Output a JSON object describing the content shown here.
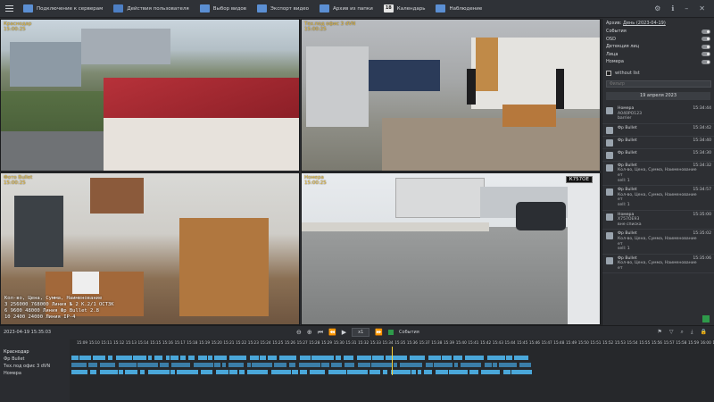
{
  "toolbar": {
    "buttons": [
      {
        "label": "Подключение к серверам",
        "icon": "server-icon"
      },
      {
        "label": "Действия пользователя",
        "icon": "user-icon"
      },
      {
        "label": "Выбор видов",
        "icon": "grid-icon"
      },
      {
        "label": "Экспорт видео",
        "icon": "export-icon"
      },
      {
        "label": "Архив из папки",
        "icon": "folder-icon"
      },
      {
        "label": "Календарь",
        "icon": "calendar-icon",
        "badge": "18"
      },
      {
        "label": "Наблюдение",
        "icon": "monitor-icon"
      }
    ]
  },
  "cameras": [
    {
      "label": "Краснодар",
      "timestamp": "15:00:25"
    },
    {
      "label": "Тех.под офис 3 dVN",
      "timestamp": "15:00:25"
    },
    {
      "label": "Фото Bullet",
      "timestamp": "15:00:25"
    },
    {
      "label": "Номера",
      "timestamp": "15:00:25"
    }
  ],
  "overlay": {
    "header": "Кол-во, Цена, Сумма, Наименование",
    "rows": [
      "3      256000   768000  Линия № 2 К.2/1 ОСТ3К",
      "6       9600   48000  Линия Фр Bullet 2.8",
      "10      2400   24000  Линия IP-4"
    ]
  },
  "plate_tag": "К757ОЕ",
  "panel": {
    "archive_label": "Архив:",
    "archive_date": "День (2023-04-19)",
    "filters": [
      "События",
      "OSD",
      "Детекция лиц",
      "Лица",
      "Номера"
    ],
    "without_list": "without list",
    "search_placeholder": "Фильтр",
    "date_bar": "19 апреля 2023",
    "events": [
      {
        "title": "Номера",
        "time": "15:34:44",
        "lines": [
          "А040РО123",
          "barrier"
        ]
      },
      {
        "title": "Фр Bullet",
        "time": "15:34:42",
        "lines": []
      },
      {
        "title": "Фр Bullet",
        "time": "15:34:40",
        "lines": []
      },
      {
        "title": "Фр Bullet",
        "time": "15:34:30",
        "lines": []
      },
      {
        "title": "Фр Bullet",
        "time": "15:34:32",
        "lines": [
          "Кол-во, Цена, Сумма, Наименование",
          "ет",
          "sell: 1"
        ]
      },
      {
        "title": "Фр Bullet",
        "time": "15:34:57",
        "lines": [
          "Кол-во, Цена, Сумма, Наименование",
          "ет",
          "sell: 1"
        ]
      },
      {
        "title": "Номера",
        "time": "15:35:00",
        "lines": [
          "Х757ОЕ93",
          "вне списка"
        ]
      },
      {
        "title": "Фр Bullet",
        "time": "15:35:02",
        "lines": [
          "Кол-во, Цена, Сумма, Наименование",
          "ет",
          "sell: 1"
        ]
      },
      {
        "title": "Фр Bullet",
        "time": "15:35:06",
        "lines": [
          "Кол-во, Цена, Сумма, Наименование",
          "ет"
        ]
      }
    ]
  },
  "controls": {
    "datetime": "2023-04-19 15:35:03",
    "speed": "x1",
    "events_label": "События"
  },
  "timeline": {
    "group": "Краснодар",
    "channels": [
      "Фр Bullet",
      "Тех.под офис 3 dVN",
      "Номера"
    ],
    "ticks": [
      "15:09",
      "15:10",
      "15:11",
      "15:12",
      "15:13",
      "15:14",
      "15:15",
      "15:16",
      "15:17",
      "15:18",
      "15:19",
      "15:20",
      "15:21",
      "15:22",
      "15:23",
      "15:24",
      "15:25",
      "15:26",
      "15:27",
      "15:28",
      "15:29",
      "15:30",
      "15:31",
      "15:32",
      "15:33",
      "15:34",
      "15:35",
      "15:36",
      "15:37",
      "15:38",
      "15:39",
      "15:40",
      "15:41",
      "15:42",
      "15:43",
      "15:44",
      "15:45",
      "15:46",
      "15:47",
      "15:48",
      "15:49",
      "15:50",
      "15:51",
      "15:52",
      "15:53",
      "15:54",
      "15:55",
      "15:56",
      "15:57",
      "15:58",
      "15:59",
      "16:00",
      "16:01"
    ]
  }
}
